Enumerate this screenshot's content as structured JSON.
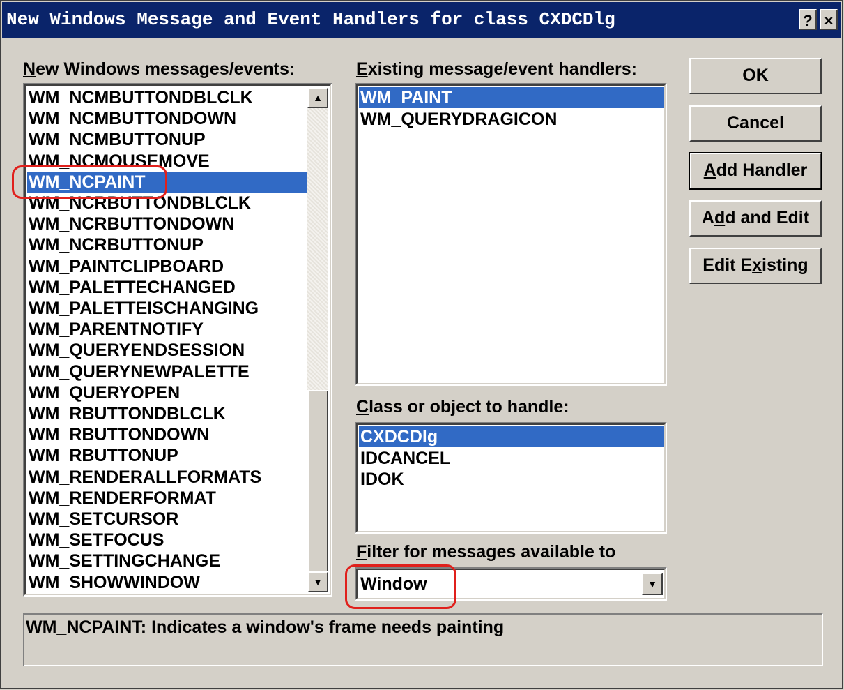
{
  "window": {
    "title": "New Windows Message and Event Handlers for class CXDCDlg",
    "help_btn": "?",
    "close_btn": "×"
  },
  "messages_panel": {
    "label_prefix": "N",
    "label_rest": "ew Windows messages/events:",
    "items": [
      "WM_NCMBUTTONDBLCLK",
      "WM_NCMBUTTONDOWN",
      "WM_NCMBUTTONUP",
      "WM_NCMOUSEMOVE",
      "WM_NCPAINT",
      "WM_NCRBUTTONDBLCLK",
      "WM_NCRBUTTONDOWN",
      "WM_NCRBUTTONUP",
      "WM_PAINTCLIPBOARD",
      "WM_PALETTECHANGED",
      "WM_PALETTEISCHANGING",
      "WM_PARENTNOTIFY",
      "WM_QUERYENDSESSION",
      "WM_QUERYNEWPALETTE",
      "WM_QUERYOPEN",
      "WM_RBUTTONDBLCLK",
      "WM_RBUTTONDOWN",
      "WM_RBUTTONUP",
      "WM_RENDERALLFORMATS",
      "WM_RENDERFORMAT",
      "WM_SETCURSOR",
      "WM_SETFOCUS",
      "WM_SETTINGCHANGE",
      "WM_SHOWWINDOW"
    ],
    "selected": "WM_NCPAINT"
  },
  "handlers_panel": {
    "label_prefix": "E",
    "label_rest": "xisting message/event handlers:",
    "items": [
      "WM_PAINT",
      "WM_QUERYDRAGICON"
    ],
    "selected": "WM_PAINT"
  },
  "class_panel": {
    "label_prefix": "C",
    "label_rest": "lass or object to handle:",
    "items": [
      "CXDCDlg",
      "IDCANCEL",
      "IDOK"
    ],
    "selected": "CXDCDlg"
  },
  "filter": {
    "label_prefix": "F",
    "label_rest": "ilter for messages available to",
    "value": "Window"
  },
  "buttons": {
    "ok": "OK",
    "cancel": "Cancel",
    "add_handler_prefix": "A",
    "add_handler_rest": "dd Handler",
    "add_edit_a": "A",
    "add_edit_d": "d",
    "add_edit_rest": "d and Edit",
    "edit_existing_pre": "Edit E",
    "edit_existing_x": "x",
    "edit_existing_rest": "isting"
  },
  "status": {
    "description": "WM_NCPAINT:  Indicates a window's frame needs painting"
  },
  "colors": {
    "title_bar": "#0a246a",
    "selection": "#316ac5",
    "highlight_oval": "#e0201c",
    "face": "#d4d0c8"
  }
}
